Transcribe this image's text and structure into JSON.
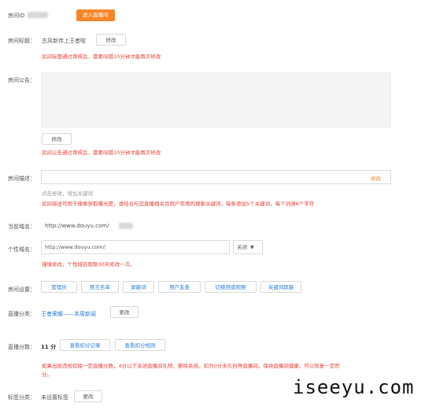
{
  "room": {
    "id_label": "房间ID",
    "enter_button": "进入直播间"
  },
  "title_row": {
    "label": "房间标题：",
    "value": "古风新传上王者啦",
    "edit_button": "修改",
    "notice": "房间标题通过审核后，需要间隔10分钟才能再次修改"
  },
  "announcement": {
    "label": "房间公告：",
    "edit_button": "修改",
    "notice": "房间公告通过审核后，需要间隔10分钟才能再次修改"
  },
  "description": {
    "label": "房间描述：",
    "action": "修改",
    "hint": "点击修改，增加关键词",
    "notice": "房间描述可用于搜索获取曝光度，请结合与您直播相关且用户常用的搜索关键词，每条添加5个关键词，每个词语6个字符"
  },
  "domain_row": {
    "label": "当前域名：",
    "value": "http://www.douyu.com/"
  },
  "custom_domain": {
    "label": "个性域名：",
    "input_value": "http://www.douyu.com/",
    "select_value": "关闭",
    "select_arrow": "▼",
    "notice": "谨慎修改，个性域名限制30天修改一次。"
  },
  "settings": {
    "label": "房间设置：",
    "buttons": [
      "管理员",
      "禁言名单",
      "屏蔽词",
      "用户友善",
      "切换频道观察",
      "关键词屏蔽"
    ]
  },
  "category": {
    "label": "直播分类：",
    "value": "王者荣耀——本周新闻",
    "edit_button": "更改"
  },
  "score": {
    "label": "直播分数：",
    "value": "11 分",
    "buttons": [
      "查看扣分记录",
      "查看扣分规则"
    ],
    "notice_line1": "如果出现违规扣除一定直播分数，4分以下关闭直播间礼物、删除系统。扣为0分永久封停直播间。保持直播间健康，可以恢复一定积",
    "notice_line2": "分。"
  },
  "tag": {
    "label": "标签分类：",
    "value": "未设置标签",
    "edit_button": "更改"
  },
  "watermark": "iseeyu.com",
  "colors": {
    "accent_orange": "#f5872a",
    "warning_red": "#e8403a",
    "link_blue": "#2b7dd8"
  }
}
